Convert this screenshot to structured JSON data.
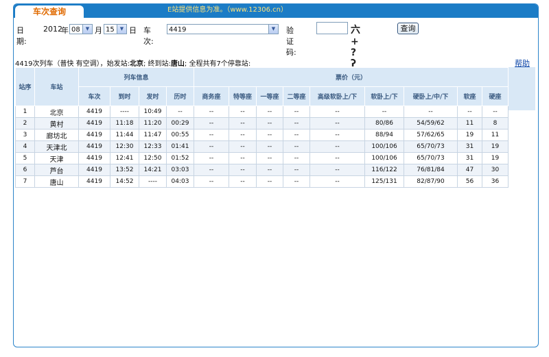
{
  "tab": {
    "title": "车次查询"
  },
  "marquee": "E站提供信息为准。（www.12306.cn）",
  "form": {
    "date_label": "日期:",
    "year_value": "2012",
    "year_unit": "年",
    "month_value": "08",
    "month_unit": "月",
    "day_value": "15",
    "day_unit": "日",
    "train_label": "车次:",
    "train_value": "4419",
    "captcha_label": "验证码:",
    "captcha_text": "六+ ?ʔ",
    "query_button": "查询"
  },
  "info": {
    "prefix": "4419次列车（普快 有空调），始发站:",
    "origin": "北京",
    "mid": "; 终到站:",
    "terminal": "唐山",
    "suffix": "; 全程共有7个停靠站:"
  },
  "help_link": "帮助",
  "table": {
    "head": {
      "seq": "站序",
      "station": "车站",
      "train_info": "列车信息",
      "fare": "票价（元）",
      "cols": [
        "车次",
        "到时",
        "发时",
        "历时",
        "商务座",
        "特等座",
        "一等座",
        "二等座",
        "高级软卧上/下",
        "软卧上/下",
        "硬卧上/中/下",
        "软座",
        "硬座"
      ]
    },
    "rows": [
      [
        "1",
        "北京",
        "4419",
        "----",
        "10:49",
        "--",
        "--",
        "--",
        "--",
        "--",
        "--",
        "--",
        "--",
        "--",
        "--"
      ],
      [
        "2",
        "黄村",
        "4419",
        "11:18",
        "11:20",
        "00:29",
        "--",
        "--",
        "--",
        "--",
        "--",
        "80/86",
        "54/59/62",
        "11",
        "8"
      ],
      [
        "3",
        "廊坊北",
        "4419",
        "11:44",
        "11:47",
        "00:55",
        "--",
        "--",
        "--",
        "--",
        "--",
        "88/94",
        "57/62/65",
        "19",
        "11"
      ],
      [
        "4",
        "天津北",
        "4419",
        "12:30",
        "12:33",
        "01:41",
        "--",
        "--",
        "--",
        "--",
        "--",
        "100/106",
        "65/70/73",
        "31",
        "19"
      ],
      [
        "5",
        "天津",
        "4419",
        "12:41",
        "12:50",
        "01:52",
        "--",
        "--",
        "--",
        "--",
        "--",
        "100/106",
        "65/70/73",
        "31",
        "19"
      ],
      [
        "6",
        "芦台",
        "4419",
        "13:52",
        "14:21",
        "03:03",
        "--",
        "--",
        "--",
        "--",
        "--",
        "116/122",
        "76/81/84",
        "47",
        "30"
      ],
      [
        "7",
        "唐山",
        "4419",
        "14:52",
        "----",
        "04:03",
        "--",
        "--",
        "--",
        "--",
        "--",
        "125/131",
        "82/87/90",
        "56",
        "36"
      ]
    ]
  }
}
